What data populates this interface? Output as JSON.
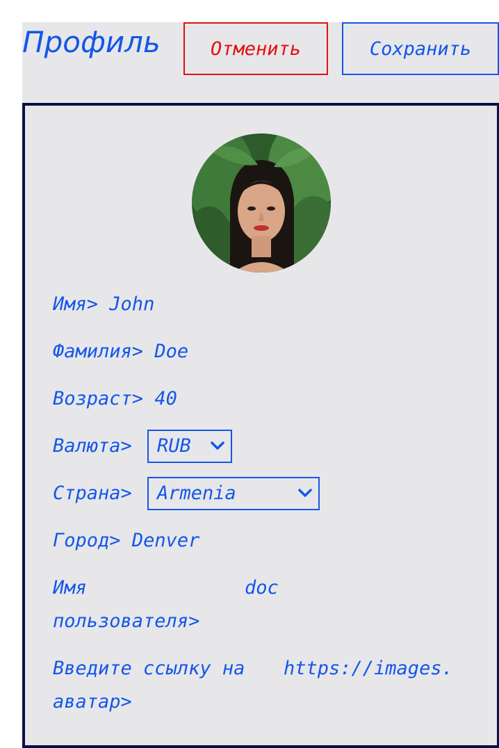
{
  "header": {
    "title": "Профиль",
    "cancel_label": "Отменить",
    "save_label": "Сохранить"
  },
  "colors": {
    "accent": "#1456e8",
    "danger": "#e31010",
    "border": "#0a0f45",
    "panel": "#e7e7ea"
  },
  "profile": {
    "avatar_alt": "avatar",
    "first_name": {
      "label": "Имя>",
      "value": "John"
    },
    "last_name": {
      "label": "Фамилия>",
      "value": "Doe"
    },
    "age": {
      "label": "Возраст>",
      "value": "40"
    },
    "currency": {
      "label": "Валюта>",
      "value": "RUB"
    },
    "country": {
      "label": "Страна>",
      "value": "Armenia"
    },
    "city": {
      "label": "Город>",
      "value": "Denver"
    },
    "username": {
      "label_line1": "Имя",
      "label_line2": "пользователя>",
      "value": "doc"
    },
    "avatar_link": {
      "label_line1": "Введите ссылку на",
      "label_line2": "аватар>",
      "value": "https://images."
    }
  }
}
